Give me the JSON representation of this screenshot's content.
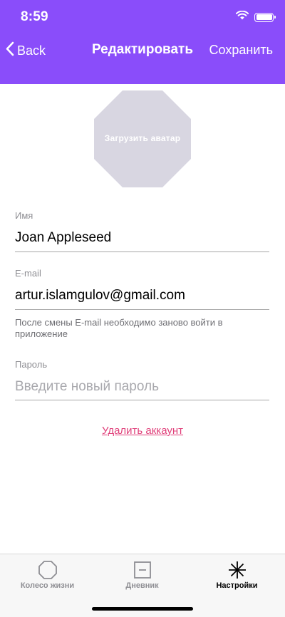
{
  "status_bar": {
    "time": "8:59",
    "icons": [
      "wifi-icon",
      "battery-icon"
    ]
  },
  "nav": {
    "back_label": "Back",
    "title": "Редактировать",
    "save_label": "Сохранить"
  },
  "avatar": {
    "label": "Загрузить аватар"
  },
  "form": {
    "name": {
      "label": "Имя",
      "value": "Joan Appleseed"
    },
    "email": {
      "label": "E-mail",
      "value": "artur.islamgulov@gmail.com",
      "hint": "После смены E-mail необходимо заново войти в приложение"
    },
    "password": {
      "label": "Пароль",
      "value": "",
      "placeholder": "Введите новый пароль"
    }
  },
  "delete_account_label": "Удалить аккаунт",
  "tabbar": {
    "tabs": [
      {
        "label": "Колесо жизни",
        "icon": "octagon-icon",
        "active": false
      },
      {
        "label": "Дневник",
        "icon": "minus-square-icon",
        "active": false
      },
      {
        "label": "Настройки",
        "icon": "asterisk-icon",
        "active": true
      }
    ]
  },
  "colors": {
    "header_bg": "#8a4dfa",
    "avatar_bg": "#d8d6e1",
    "delete_link": "#e0407a",
    "tabbar_bg": "#f7f7f7"
  }
}
